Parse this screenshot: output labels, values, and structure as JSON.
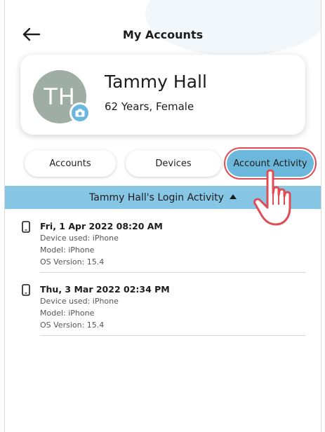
{
  "header": {
    "title": "My Accounts",
    "back_icon": "back-arrow-icon"
  },
  "profile": {
    "initials": "TH",
    "name": "Tammy Hall",
    "meta": "62 Years, Female",
    "avatar_color": "#9eaea5",
    "camera_icon": "camera-icon",
    "camera_color": "#69b6df"
  },
  "tabs": [
    {
      "label": "Accounts",
      "active": false
    },
    {
      "label": "Devices",
      "active": false
    },
    {
      "label": "Account Activity",
      "active": true
    }
  ],
  "activity_section": {
    "title": "Tammy Hall's Login Activity",
    "expanded": true,
    "bar_color": "#87c6e5"
  },
  "activities": [
    {
      "datetime": "Fri, 1 Apr 2022 08:20 AM",
      "device": "Device used: iPhone",
      "model": "Model: iPhone",
      "os": "OS Version: 15.4",
      "icon": "phone-icon"
    },
    {
      "datetime": "Thu,  3 Mar 2022 02:34 PM",
      "device": "Device used: iPhone",
      "model": "Model: iPhone",
      "os": "OS Version: 15.4",
      "icon": "phone-icon"
    }
  ],
  "colors": {
    "active_tab": "#6cb8dc",
    "highlight_ring": "#e04c55"
  }
}
